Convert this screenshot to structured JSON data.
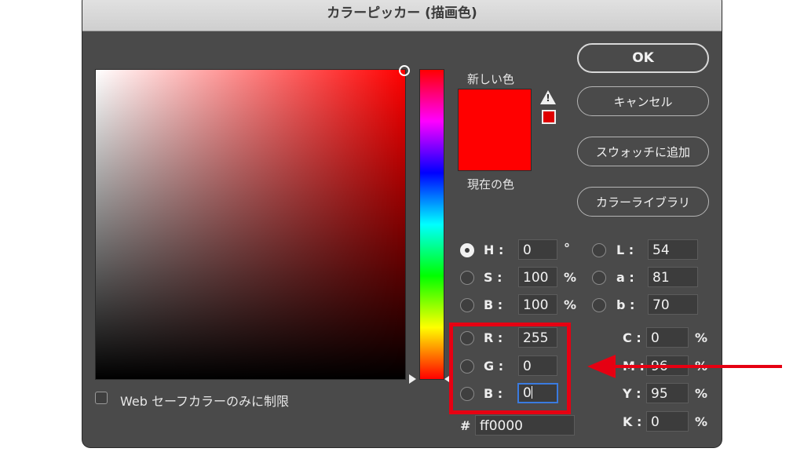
{
  "window": {
    "title": "カラーピッカー (描画色)"
  },
  "preview": {
    "new_label": "新しい色",
    "current_label": "現在の色",
    "new_color": "#ff0000",
    "current_color": "#ff0000"
  },
  "buttons": {
    "ok": "OK",
    "cancel": "キャンセル",
    "add_swatch": "スウォッチに追加",
    "libraries": "カラーライブラリ"
  },
  "hsb": {
    "h": {
      "label": "H :",
      "value": "0",
      "unit": "°"
    },
    "s": {
      "label": "S :",
      "value": "100",
      "unit": "%"
    },
    "b": {
      "label": "B :",
      "value": "100",
      "unit": "%"
    },
    "selected": "H"
  },
  "lab": {
    "l": {
      "label": "L :",
      "value": "54"
    },
    "a": {
      "label": "a :",
      "value": "81"
    },
    "b": {
      "label": "b :",
      "value": "70"
    }
  },
  "rgb": {
    "r": {
      "label": "R :",
      "value": "255"
    },
    "g": {
      "label": "G :",
      "value": "0"
    },
    "b": {
      "label": "B :",
      "value": "0"
    }
  },
  "cmyk": {
    "c": {
      "label": "C :",
      "value": "0",
      "unit": "%"
    },
    "m": {
      "label": "M :",
      "value": "96",
      "unit": "%"
    },
    "y": {
      "label": "Y :",
      "value": "95",
      "unit": "%"
    },
    "k": {
      "label": "K :",
      "value": "0",
      "unit": "%"
    }
  },
  "hex": {
    "label": "#",
    "value": "ff0000"
  },
  "web_only": {
    "label": "Web セーフカラーのみに制限",
    "checked": false
  },
  "icons": {
    "warning": "warning-triangle-icon",
    "gamut": "out-of-gamut-swatch"
  },
  "annotation_color": "#e60012"
}
